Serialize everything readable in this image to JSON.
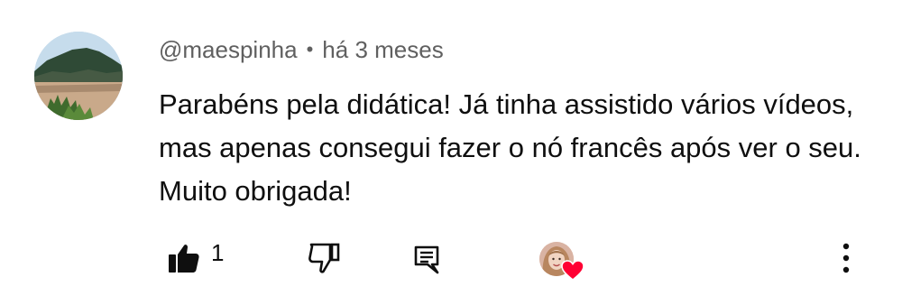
{
  "comment": {
    "username": "@maespinha",
    "separator": "•",
    "timestamp": "há 3 meses",
    "text": "Parabéns pela didática! Já tinha assistido vários vídeos, mas apenas consegui fazer o nó francês após ver o seu. Muito obrigada!",
    "like_count": "1"
  },
  "icons": {
    "like": "thumbs-up-filled-icon",
    "dislike": "thumbs-down-outline-icon",
    "reply": "comment-reply-icon",
    "creator_heart": "heart-icon",
    "more": "more-vertical-icon"
  },
  "colors": {
    "text_primary": "#0f0f0f",
    "text_secondary": "#606060",
    "heart": "#ff0033"
  }
}
